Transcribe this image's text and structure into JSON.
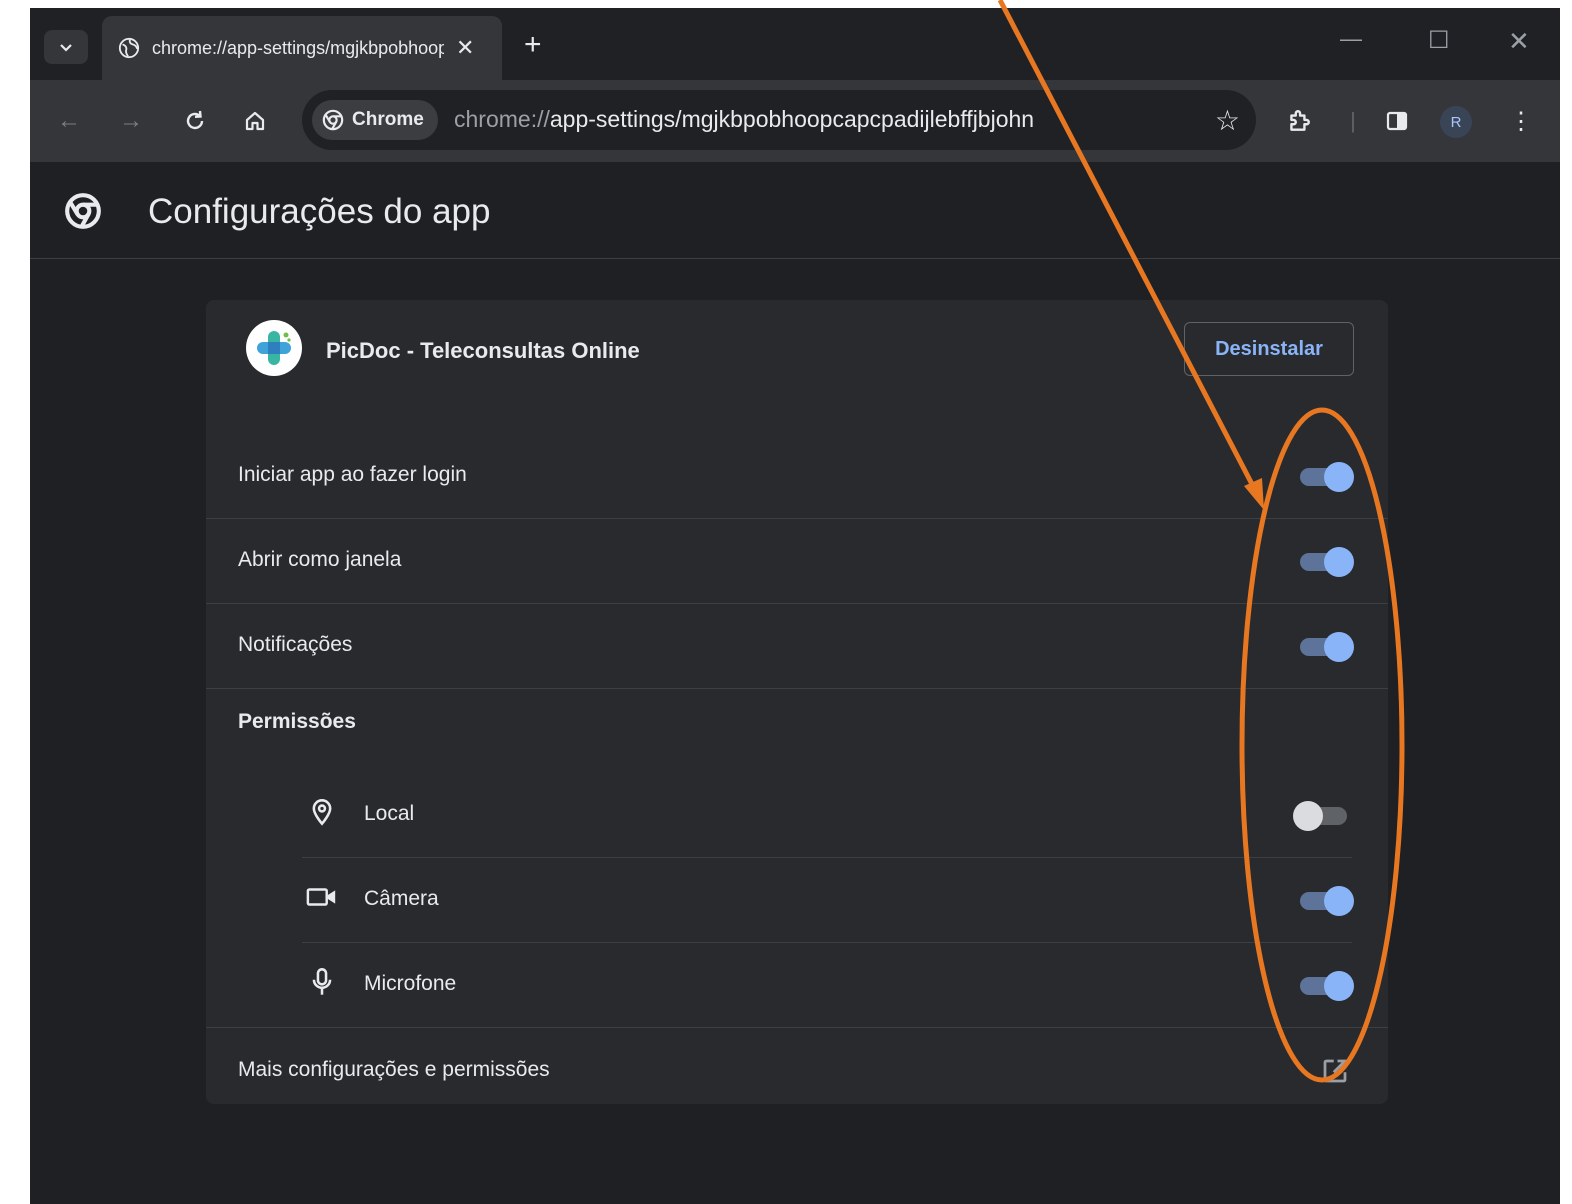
{
  "tab": {
    "title": "chrome://app-settings/mgjkbpobhoopcapcpadijlebffjbjohn"
  },
  "omnibox": {
    "chip_label": "Chrome",
    "url_scheme": "chrome://",
    "url_rest": "app-settings/mgjkbpobhoopcapcpadijlebffjbjohn"
  },
  "profile": {
    "initial": "R"
  },
  "page": {
    "title": "Configurações do app"
  },
  "app": {
    "name": "PicDoc - Teleconsultas Online",
    "uninstall_label": "Desinstalar"
  },
  "settings": [
    {
      "label": "Iniciar app ao fazer login",
      "enabled": true
    },
    {
      "label": "Abrir como janela",
      "enabled": true
    },
    {
      "label": "Notificações",
      "enabled": true
    }
  ],
  "permissions": {
    "heading": "Permissões",
    "items": [
      {
        "label": "Local",
        "icon": "location-pin-icon",
        "enabled": false
      },
      {
        "label": "Câmera",
        "icon": "camera-icon",
        "enabled": true
      },
      {
        "label": "Microfone",
        "icon": "microphone-icon",
        "enabled": true
      }
    ]
  },
  "more": {
    "label": "Mais configurações e permissões",
    "icon": "open-in-new-icon"
  },
  "colors": {
    "accent": "#8ab4f8",
    "annotation": "#e87722",
    "background": "#1f2023",
    "card": "#292a2d"
  }
}
